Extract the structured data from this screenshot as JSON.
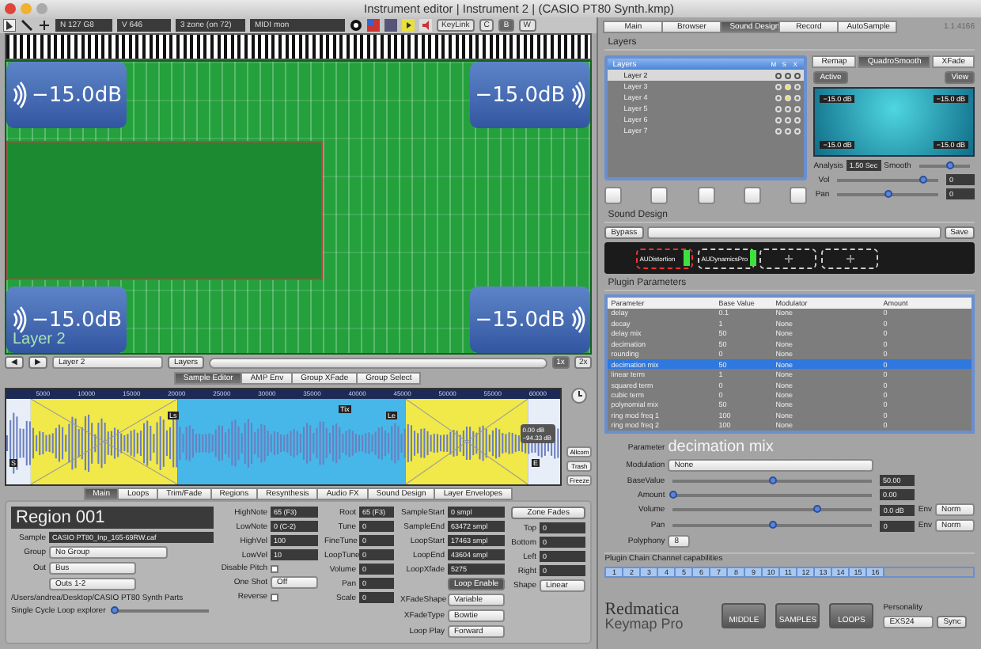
{
  "window": {
    "title": "Instrument editor | Instrument 2 | (CASIO PT80 Synth.kmp)"
  },
  "toolbar": {
    "fields": [
      "N 127 G8",
      "V 646",
      "3 zone (on 72)",
      "MIDI mon"
    ],
    "keylink": "KeyLink",
    "modes": [
      {
        "label": "C",
        "selected": false
      },
      {
        "label": "B",
        "selected": true
      },
      {
        "label": "W",
        "selected": false
      }
    ]
  },
  "zone_map": {
    "layer_label": "Layer 2",
    "corners": [
      "−15.0dB",
      "−15.0dB",
      "−15.0dB",
      "−15.0dB"
    ]
  },
  "layer_bar": {
    "nav": [
      "◀",
      "▶"
    ],
    "layer": "Layer 2",
    "layers_button": "Layers",
    "zoom": [
      {
        "label": "1x",
        "selected": true
      },
      {
        "label": "2x",
        "selected": false
      }
    ]
  },
  "editor_tabs": [
    {
      "label": "Sample Editor",
      "selected": true
    },
    {
      "label": "AMP Env",
      "selected": false
    },
    {
      "label": "Group XFade",
      "selected": false
    },
    {
      "label": "Group Select",
      "selected": false
    }
  ],
  "waveform": {
    "ruler": [
      "5000",
      "10000",
      "15000",
      "20000",
      "25000",
      "30000",
      "35000",
      "40000",
      "45000",
      "50000",
      "55000",
      "60000"
    ],
    "markers": [
      {
        "label": "S",
        "kind": "start"
      },
      {
        "label": "Ls",
        "kind": "loop"
      },
      {
        "label": "Tix",
        "kind": "loop"
      },
      {
        "label": "Le",
        "kind": "loop"
      },
      {
        "label": "E",
        "kind": "end"
      }
    ],
    "readout": "0.00 dB −94.33 dB",
    "buttons": [
      "Allcom",
      "Trash",
      "Freeze"
    ]
  },
  "region_tabs": [
    {
      "label": "Main",
      "selected": true
    },
    {
      "label": "Loops",
      "selected": false
    },
    {
      "label": "Trim/Fade",
      "selected": false
    },
    {
      "label": "Regions",
      "selected": false
    },
    {
      "label": "Resynthesis",
      "selected": false
    },
    {
      "label": "Audio FX",
      "selected": false
    },
    {
      "label": "Sound Design",
      "selected": false
    },
    {
      "label": "Layer Envelopes",
      "selected": false
    }
  ],
  "region": {
    "name": "Region 001",
    "fields": [
      {
        "label": "Sample",
        "value": "CASIO PT80_Inp_165-69RW.caf"
      },
      {
        "label": "Group",
        "value": "No Group"
      },
      {
        "label": "Out",
        "value": "Bus"
      }
    ],
    "outs": "Outs 1-2",
    "path": "/Users/andrea/Desktop/CASIO PT80 Synth Parts",
    "loop_explorer": {
      "label": "Single Cycle Loop explorer",
      "level": 0
    },
    "notes": [
      {
        "label": "HighNote",
        "value": "65 (F3)"
      },
      {
        "label": "LowNote",
        "value": "0 (C-2)"
      },
      {
        "label": "HighVel",
        "value": "100"
      },
      {
        "label": "LowVel",
        "value": "10"
      }
    ],
    "disable_pitch": {
      "label": "Disable Pitch",
      "checked": false
    },
    "one_shot": {
      "label": "One Shot",
      "value": "Off"
    },
    "reverse": {
      "label": "Reverse",
      "checked": false
    },
    "tuning": [
      {
        "label": "Root",
        "value": "65 (F3)"
      },
      {
        "label": "Tune",
        "value": "0"
      },
      {
        "label": "FineTune",
        "value": "0"
      },
      {
        "label": "LoopTune",
        "value": "0"
      },
      {
        "label": "Volume",
        "value": "0"
      },
      {
        "label": "Pan",
        "value": "0"
      },
      {
        "label": "Scale",
        "value": "0"
      }
    ],
    "loop": [
      {
        "label": "SampleStart",
        "value": "0 smpl"
      },
      {
        "label": "SampleEnd",
        "value": "63472 smpl"
      },
      {
        "label": "LoopStart",
        "value": "17463 smpl"
      },
      {
        "label": "LoopEnd",
        "value": "43604 smpl"
      },
      {
        "label": "LoopXfade",
        "value": "5275"
      }
    ],
    "loop_enable": "Loop Enable",
    "loop_options": [
      {
        "label": "XFadeShape",
        "value": "Variable"
      },
      {
        "label": "XFadeType",
        "value": "Bowtie"
      },
      {
        "label": "Loop Play",
        "value": "Forward"
      }
    ],
    "zone_fades": {
      "button": "Zone Fades",
      "fields": [
        {
          "label": "Top",
          "value": "0"
        },
        {
          "label": "Bottom",
          "value": "0"
        },
        {
          "label": "Left",
          "value": "0"
        },
        {
          "label": "Right",
          "value": "0"
        }
      ],
      "shape_label": "Shape",
      "shape": "Linear"
    }
  },
  "main_tabs": [
    {
      "label": "Main",
      "selected": false
    },
    {
      "label": "Browser",
      "selected": false
    },
    {
      "label": "Sound Design",
      "selected": true
    },
    {
      "label": "Record",
      "selected": false
    },
    {
      "label": "AutoSample",
      "selected": false
    }
  ],
  "version": "1.1.4166",
  "layers": {
    "title": "Layers",
    "header": "Layers",
    "columns": [
      "M",
      "S",
      "X"
    ],
    "rows": [
      {
        "name": "Layer 2",
        "selected": true,
        "solo": false
      },
      {
        "name": "Layer 3",
        "selected": false,
        "solo": true
      },
      {
        "name": "Layer 4",
        "selected": false,
        "solo": true
      },
      {
        "name": "Layer 5",
        "selected": false,
        "solo": false
      },
      {
        "name": "Layer 6",
        "selected": false,
        "solo": false
      },
      {
        "name": "Layer 7",
        "selected": false,
        "solo": false
      }
    ],
    "mode_tabs": [
      {
        "label": "Remap",
        "selected": false
      },
      {
        "label": "QuadroSmooth",
        "selected": true
      },
      {
        "label": "XFade",
        "selected": false
      }
    ],
    "active": "Active",
    "view": "View",
    "pad": [
      "−15.0 dB",
      "−15.0 dB",
      "−15.0 dB",
      "−15.0 dB"
    ],
    "analysis_label": "Analysis",
    "analysis": "1.50 Sec",
    "smooth": {
      "label": "Smooth",
      "level": 0.6
    },
    "mix": [
      {
        "label": "Vol",
        "level": 0.85,
        "value": "0"
      },
      {
        "label": "Pan",
        "level": 0.5,
        "value": "0"
      }
    ]
  },
  "sound_design": {
    "title": "Sound Design",
    "bypass": "Bypass",
    "save": "Save",
    "plugins": [
      {
        "kind": "plugin",
        "name": "AUDistortion",
        "selected": true
      },
      {
        "kind": "plugin",
        "name": "AUDynamicsPro",
        "selected": false
      },
      {
        "kind": "empty"
      },
      {
        "kind": "empty"
      }
    ]
  },
  "plugin_parameters": {
    "title": "Plugin Parameters",
    "columns": [
      "Parameter",
      "Base Value",
      "Modulator",
      "Amount"
    ],
    "rows": [
      {
        "name": "delay",
        "base": "0.1",
        "modulator": "None",
        "amount": "0",
        "selected": false
      },
      {
        "name": "decay",
        "base": "1",
        "modulator": "None",
        "amount": "0",
        "selected": false
      },
      {
        "name": "delay mix",
        "base": "50",
        "modulator": "None",
        "amount": "0",
        "selected": false
      },
      {
        "name": "decimation",
        "base": "50",
        "modulator": "None",
        "amount": "0",
        "selected": false
      },
      {
        "name": "rounding",
        "base": "0",
        "modulator": "None",
        "amount": "0",
        "selected": false
      },
      {
        "name": "decimation mix",
        "base": "50",
        "modulator": "None",
        "amount": "0",
        "selected": true
      },
      {
        "name": "linear term",
        "base": "1",
        "modulator": "None",
        "amount": "0",
        "selected": false
      },
      {
        "name": "squared term",
        "base": "0",
        "modulator": "None",
        "amount": "0",
        "selected": false
      },
      {
        "name": "cubic term",
        "base": "0",
        "modulator": "None",
        "amount": "0",
        "selected": false
      },
      {
        "name": "polynomial mix",
        "base": "50",
        "modulator": "None",
        "amount": "0",
        "selected": false
      },
      {
        "name": "ring mod freq 1",
        "base": "100",
        "modulator": "None",
        "amount": "0",
        "selected": false
      },
      {
        "name": "ring mod freq 2",
        "base": "100",
        "modulator": "None",
        "amount": "0",
        "selected": false
      }
    ]
  },
  "detail": {
    "parameter_label": "Parameter",
    "parameter": "decimation mix",
    "modulation_label": "Modulation",
    "modulation": "None",
    "sliders": [
      {
        "label": "BaseValue",
        "level": 0.5,
        "value": "50.00"
      },
      {
        "label": "Amount",
        "level": 0,
        "value": "0.00"
      }
    ],
    "mix": [
      {
        "label": "Volume",
        "level": 0.72,
        "value": "0.0 dB",
        "env": "Env",
        "mode": "Norm"
      },
      {
        "label": "Pan",
        "level": 0.5,
        "value": "0",
        "env": "Env",
        "mode": "Norm"
      }
    ],
    "polyphony_label": "Polyphony",
    "polyphony": "8",
    "channels_title": "Plugin Chain Channel capabilities",
    "channels": [
      {
        "label": "1",
        "on": true
      },
      {
        "label": "2",
        "on": true
      },
      {
        "label": "3",
        "on": true
      },
      {
        "label": "4",
        "on": true
      },
      {
        "label": "5",
        "on": true
      },
      {
        "label": "6",
        "on": true
      },
      {
        "label": "7",
        "on": true
      },
      {
        "label": "8",
        "on": true
      },
      {
        "label": "9",
        "on": true
      },
      {
        "label": "10",
        "on": true
      },
      {
        "label": "11",
        "on": true
      },
      {
        "label": "12",
        "on": true
      },
      {
        "label": "13",
        "on": true
      },
      {
        "label": "14",
        "on": true
      },
      {
        "label": "15",
        "on": true
      },
      {
        "label": "16",
        "on": true
      }
    ]
  },
  "footer": {
    "logo_top": "Redmatica",
    "logo_bottom": "Keymap Pro",
    "buttons": [
      "MIDDLE",
      "SAMPLES",
      "LOOPS"
    ],
    "personality_label": "Personality",
    "personality": "EXS24",
    "sync": "Sync"
  }
}
